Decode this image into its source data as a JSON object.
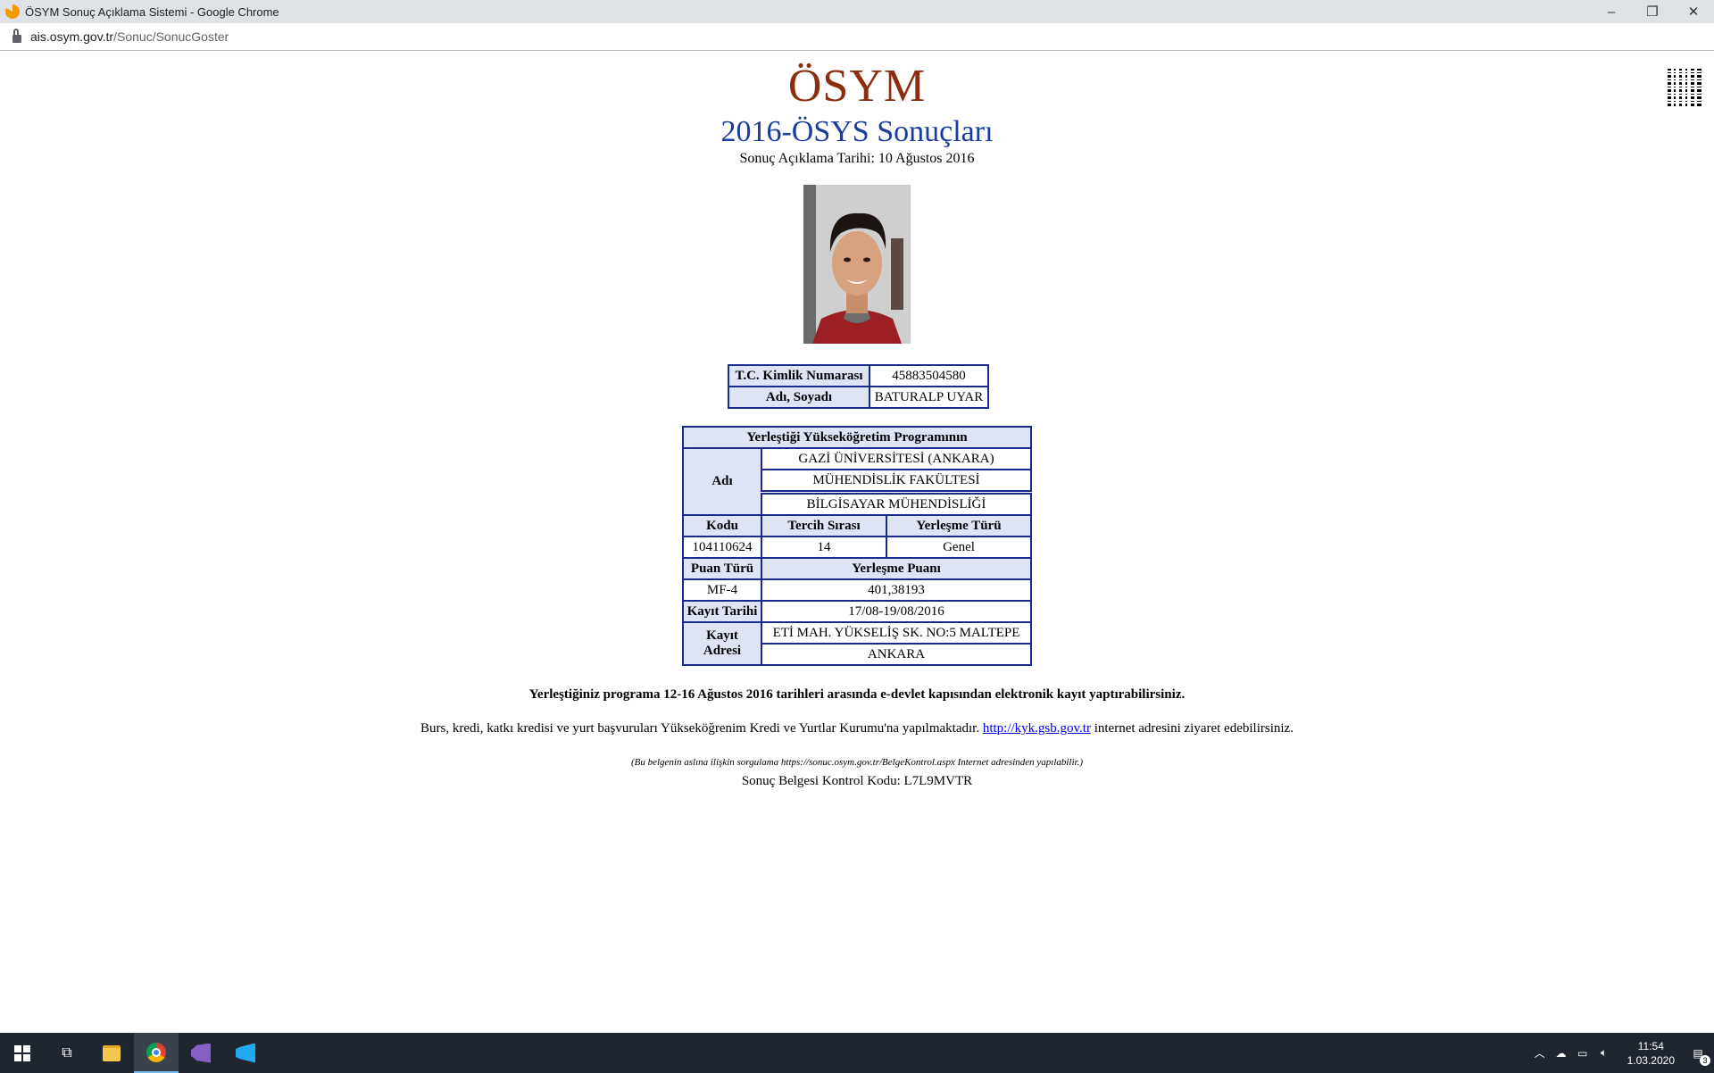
{
  "browser": {
    "window_title": "ÖSYM Sonuç Açıklama Sistemi - Google Chrome",
    "url_host": "ais.osym.gov.tr",
    "url_path": "/Sonuc/SonucGoster",
    "controls": {
      "minimize": "–",
      "restore": "❐",
      "close": "✕"
    }
  },
  "header": {
    "logo_text": "ÖSYM",
    "exam_title": "2016-ÖSYS Sonuçları",
    "announce_date": "Sonuç Açıklama Tarihi: 10 Ağustos 2016"
  },
  "identity": {
    "tc_label": "T.C. Kimlik Numarası",
    "tc_value": "45883504580",
    "name_label": "Adı, Soyadı",
    "name_value": "BATURALP UYAR"
  },
  "placement": {
    "header": "Yerleştiği Yükseköğretim Programının",
    "name_label": "Adı",
    "university": "GAZİ ÜNİVERSİTESİ (ANKARA)",
    "faculty": "MÜHENDİSLİK FAKÜLTESİ",
    "program": "BİLGİSAYAR MÜHENDİSLİĞİ",
    "code_label": "Kodu",
    "pref_label": "Tercih Sırası",
    "type_label": "Yerleşme Türü",
    "code_value": "104110624",
    "pref_value": "14",
    "type_value": "Genel",
    "score_type_label": "Puan Türü",
    "score_label": "Yerleşme Puanı",
    "score_type_value": "MF-4",
    "score_value": "401,38193",
    "reg_date_label": "Kayıt Tarihi",
    "reg_date_value": "17/08-19/08/2016",
    "reg_addr_label": "Kayıt Adresi",
    "reg_addr_line1": "ETİ MAH. YÜKSELİŞ SK. NO:5 MALTEPE",
    "reg_addr_line2": "ANKARA"
  },
  "messages": {
    "enroll": "Yerleştiğiniz programa 12-16 Ağustos 2016 tarihleri arasında e-devlet kapısından elektronik kayıt yaptırabilirsiniz.",
    "loans_pre": "Burs, kredi, katkı kredisi ve yurt başvuruları Yükseköğrenim Kredi ve Yurtlar Kurumu'na yapılmaktadır.",
    "loans_link": "http://kyk.gsb.gov.tr",
    "loans_post": "internet adresini ziyaret edebilirsiniz.",
    "verify_note": "(Bu belgenin aslına ilişkin sorgulama https://sonuc.osym.gov.tr/BelgeKontrol.aspx Internet adresinden yapılabilir.)",
    "control_code": "Sonuç Belgesi Kontrol Kodu: L7L9MVTR"
  },
  "taskbar": {
    "time": "11:54",
    "date": "1.03.2020",
    "notification_count": "3"
  }
}
